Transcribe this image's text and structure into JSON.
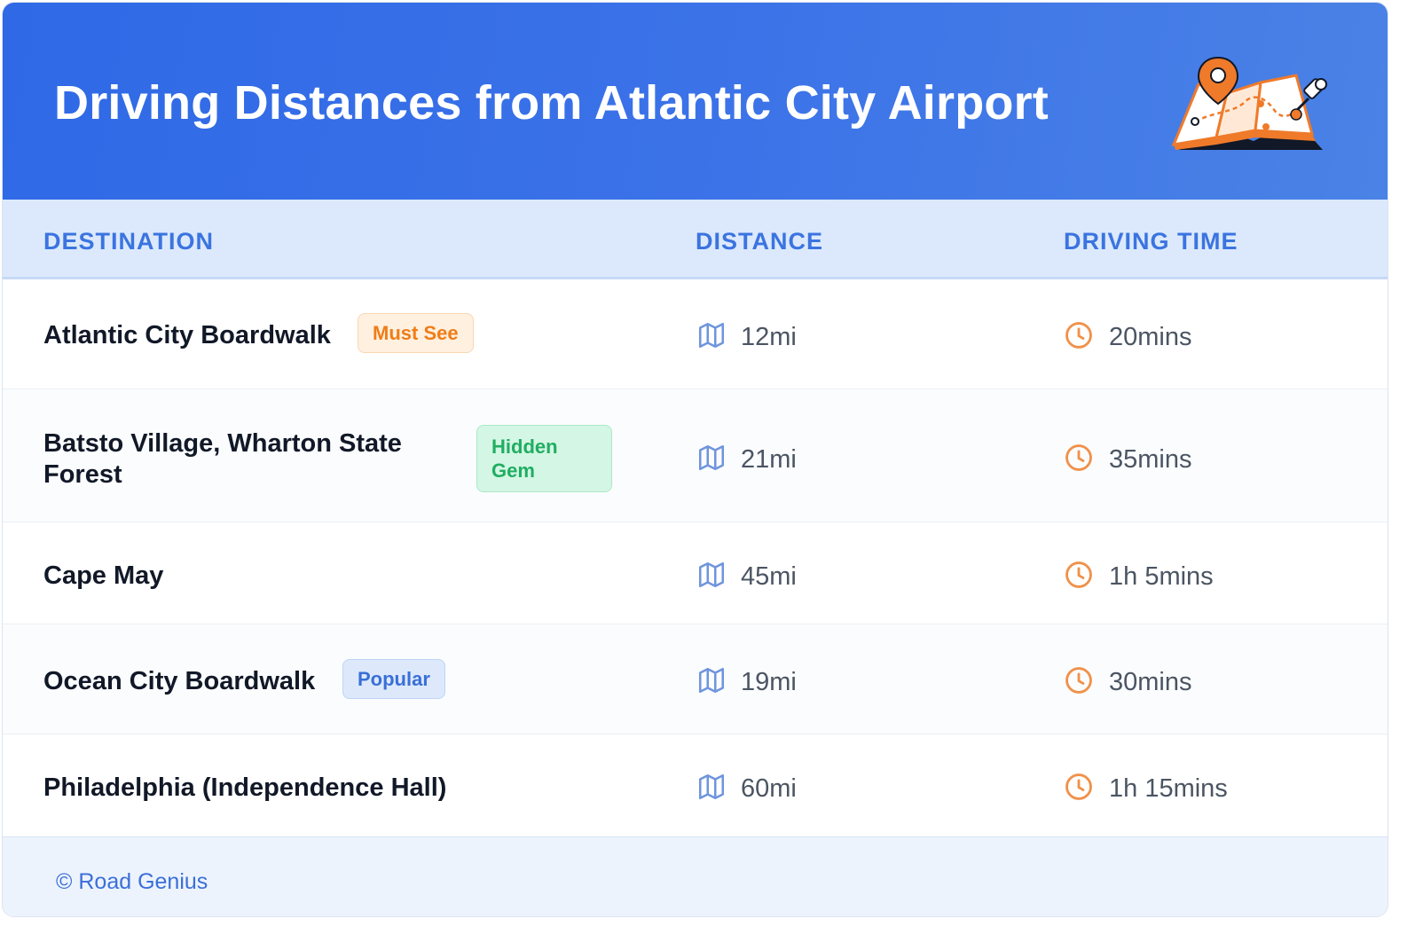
{
  "header": {
    "title": "Driving Distances from Atlantic City Airport",
    "illustration_icon": "map-with-pins-icon"
  },
  "table": {
    "columns": [
      "DESTINATION",
      "DISTANCE",
      "DRIVING TIME"
    ],
    "distance_icon": "map-icon",
    "time_icon": "clock-icon",
    "rows": [
      {
        "destination": "Atlantic City Boardwalk",
        "badge": "Must See",
        "badge_color": "orange",
        "distance": "12mi",
        "time": "20mins"
      },
      {
        "destination": "Batsto Village, Wharton State Forest",
        "badge": "Hidden Gem",
        "badge_color": "green",
        "distance": "21mi",
        "time": "35mins"
      },
      {
        "destination": "Cape May",
        "badge": "",
        "badge_color": "",
        "distance": "45mi",
        "time": "1h 5mins"
      },
      {
        "destination": "Ocean City Boardwalk",
        "badge": "Popular",
        "badge_color": "blue",
        "distance": "19mi",
        "time": "30mins"
      },
      {
        "destination": "Philadelphia (Independence Hall)",
        "badge": "",
        "badge_color": "",
        "distance": "60mi",
        "time": "1h 15mins"
      }
    ]
  },
  "footer": {
    "text": "© Road Genius"
  },
  "colors": {
    "header_gradient_start": "#2f69e6",
    "header_gradient_end": "#4a82e6",
    "accent_blue": "#3b74e0",
    "clock_orange": "#f0914a",
    "map_icon_blue": "#6f95dd"
  }
}
